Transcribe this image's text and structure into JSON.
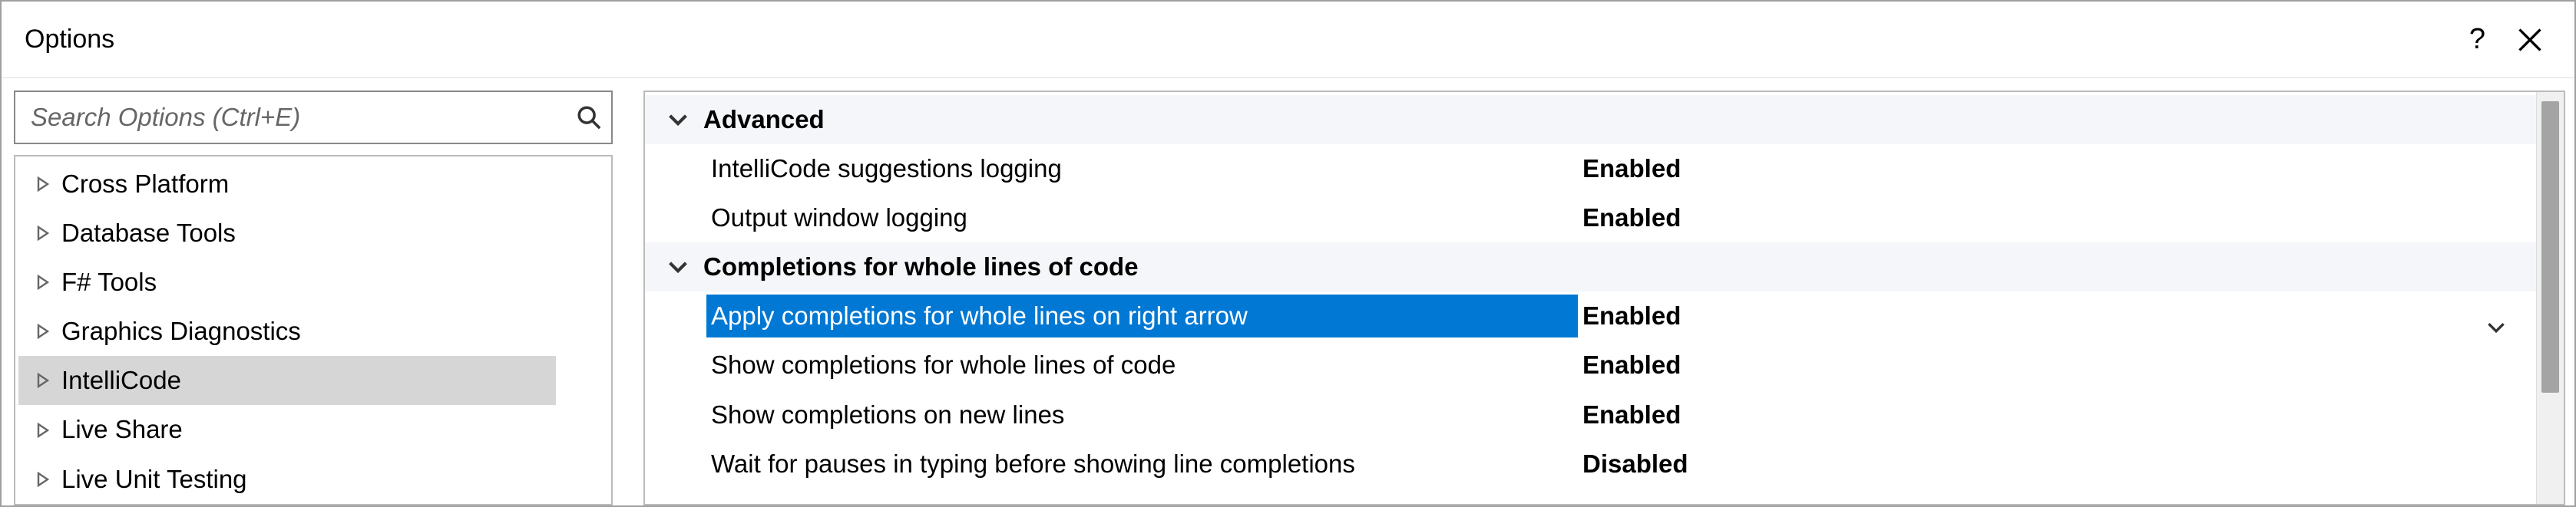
{
  "window": {
    "title": "Options",
    "help_glyph": "?"
  },
  "search": {
    "placeholder": "Search Options (Ctrl+E)"
  },
  "tree": {
    "items": [
      {
        "label": "Cross Platform",
        "selected": false
      },
      {
        "label": "Database Tools",
        "selected": false
      },
      {
        "label": "F# Tools",
        "selected": false
      },
      {
        "label": "Graphics Diagnostics",
        "selected": false
      },
      {
        "label": "IntelliCode",
        "selected": true
      },
      {
        "label": "Live Share",
        "selected": false
      },
      {
        "label": "Live Unit Testing",
        "selected": false
      }
    ]
  },
  "groups": [
    {
      "title": "Advanced",
      "rows": [
        {
          "label": "IntelliCode suggestions logging",
          "value": "Enabled",
          "selected": false
        },
        {
          "label": "Output window logging",
          "value": "Enabled",
          "selected": false
        }
      ]
    },
    {
      "title": "Completions for whole lines of code",
      "rows": [
        {
          "label": "Apply completions for whole lines on right arrow",
          "value": "Enabled",
          "selected": true
        },
        {
          "label": "Show completions for whole lines of code",
          "value": "Enabled",
          "selected": false
        },
        {
          "label": "Show completions on new lines",
          "value": "Enabled",
          "selected": false
        },
        {
          "label": "Wait for pauses in typing before showing line completions",
          "value": "Disabled",
          "selected": false
        }
      ]
    }
  ]
}
